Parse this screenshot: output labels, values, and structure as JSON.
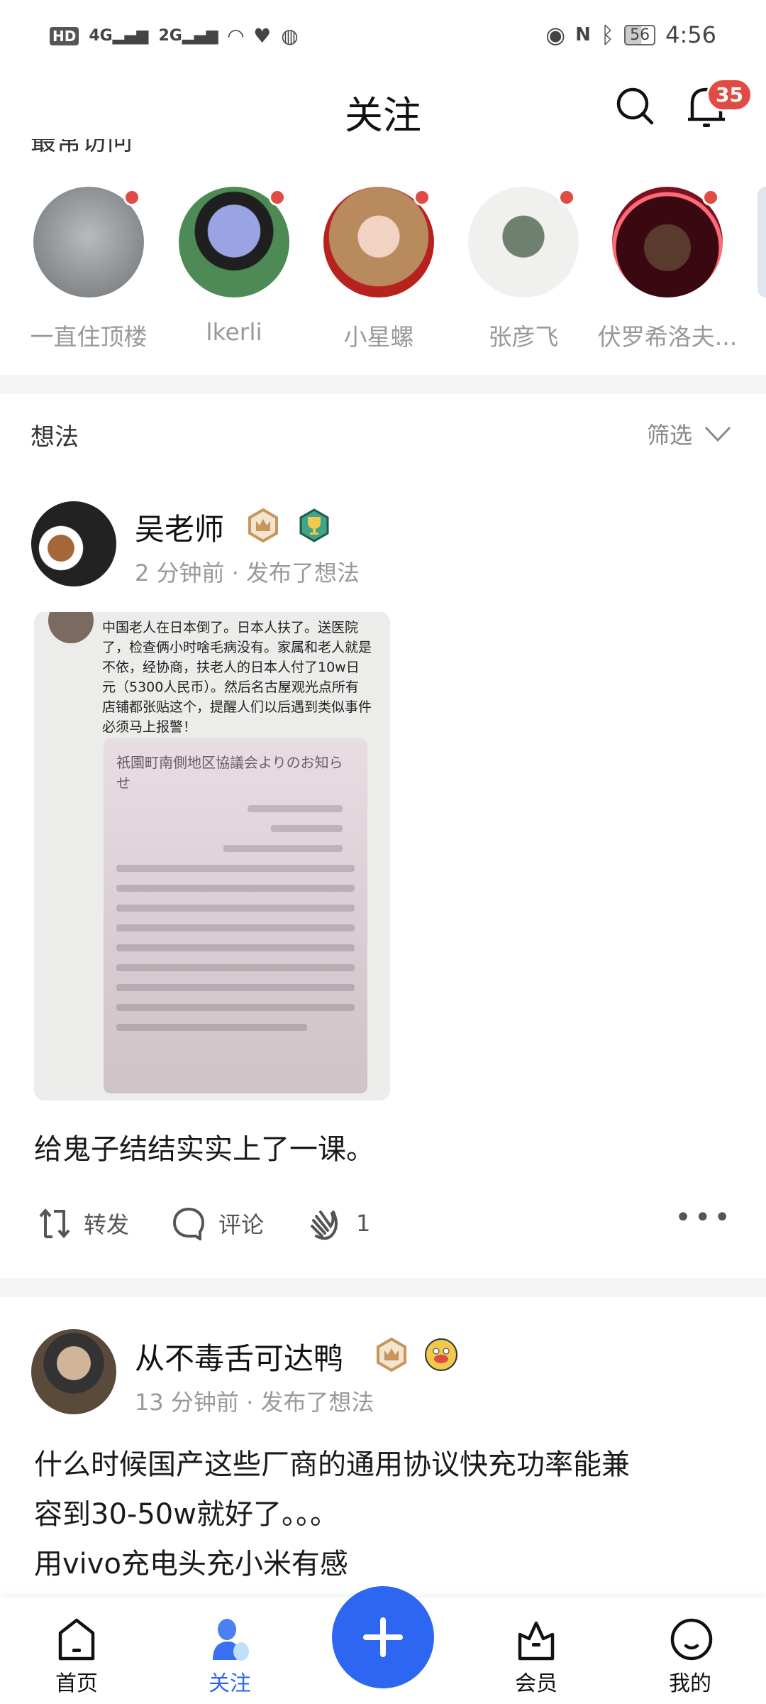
{
  "status_bar": {
    "left_labels": [
      "HD",
      "4G",
      "2G"
    ],
    "battery": "56",
    "time": "4:56",
    "icons": [
      "hd-icon",
      "signal-icon",
      "wifi-icon",
      "heart-icon",
      "vpn-icon",
      "eye-icon",
      "nfc-icon",
      "bluetooth-icon",
      "battery-icon"
    ]
  },
  "header": {
    "title": "关注",
    "notification_count": "35"
  },
  "frequent": {
    "label": "最常访问",
    "users": [
      {
        "name": "一直住顶楼",
        "color": "#8a8d90"
      },
      {
        "name": "lkerli",
        "color": "#e9a6b6"
      },
      {
        "name": "小星螺",
        "color": "#b88a5e"
      },
      {
        "name": "张彦飞",
        "color": "#dfe3de"
      },
      {
        "name": "伏罗希洛夫...",
        "color": "#8a1420"
      }
    ]
  },
  "section": {
    "title": "想法",
    "filter_label": "筛选"
  },
  "posts": [
    {
      "author": "吴老师",
      "meta": "2 分钟前 · 发布了想法",
      "image_caption": "中国老人在日本倒了。日本人扶了。送医院了，检查俩小时啥毛病没有。家属和老人就是不依，经协商，扶老人的日本人付了10w日元（5300人民币）。然后名古屋观光点所有店铺都张贴这个，提醒人们以后遇到类似事件必须马上报警！",
      "image_notice_title": "祇園町南側地区協議会よりのお知らせ",
      "text": "给鬼子结结实实上了一课。",
      "repost_label": "转发",
      "comment_label": "评论",
      "applause_count": "1"
    },
    {
      "author": "从不毒舌可达鸭",
      "meta": "13 分钟前 · 发布了想法",
      "text_lines": [
        "什么时候国产这些厂商的通用协议快充功率能兼",
        "容到30-50w就好了。。。",
        "用vivo充电头充小米有感"
      ]
    }
  ],
  "bottom_nav": [
    {
      "label": "首页"
    },
    {
      "label": "关注",
      "active": true
    },
    {
      "label": "会员"
    },
    {
      "label": "我的"
    }
  ],
  "colors": {
    "accent": "#2d66f0",
    "badge": "#e04b43"
  }
}
